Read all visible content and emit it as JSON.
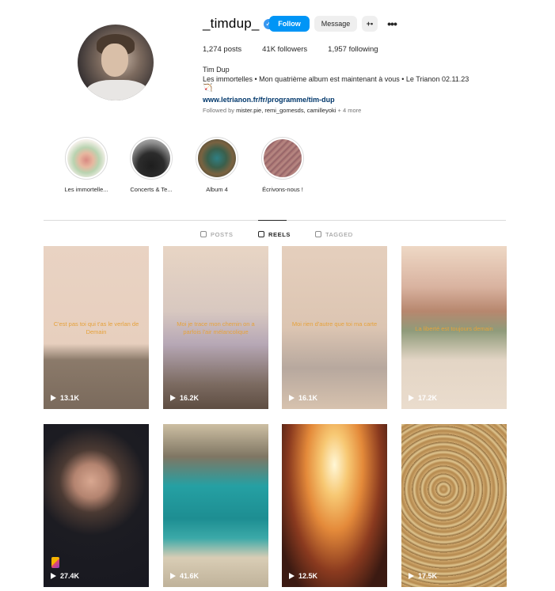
{
  "profile": {
    "username": "_timdup_",
    "verified_glyph": "✓",
    "buttons": {
      "follow": "Follow",
      "message": "Message",
      "add_user_glyph": "+•",
      "more_glyph": "•••"
    },
    "stats": {
      "posts": "1,274 posts",
      "followers": "41K followers",
      "following": "1,957 following"
    },
    "bio": {
      "name": "Tim Dup",
      "description": "Les immortelles • Mon quatrième album est maintenant à vous • Le Trianon 02.11.23",
      "emoji": "🏹",
      "link": "www.letrianon.fr/fr/programme/tim-dup"
    },
    "followed_by": {
      "prefix": "Followed by",
      "names": "mister.pie, remi_gomesds, camilleyoki",
      "more": "+ 4 more"
    }
  },
  "highlights": [
    {
      "label": "Les immortelle..."
    },
    {
      "label": "Concerts & Te..."
    },
    {
      "label": "Album 4"
    },
    {
      "label": "Écrivons-nous !"
    }
  ],
  "tabs": [
    {
      "label": "POSTS",
      "active": false
    },
    {
      "label": "REELS",
      "active": true
    },
    {
      "label": "TAGGED",
      "active": false
    }
  ],
  "reels": [
    {
      "views": "13.1K",
      "caption": "C'est pas toi qui t'as le verlan de Demain"
    },
    {
      "views": "16.2K",
      "caption": "Moi je trace mon chemin on a parfois l'air mélancolique"
    },
    {
      "views": "16.1K",
      "caption": "Moi rien d'autre que toi ma carte"
    },
    {
      "views": "17.2K",
      "caption": "La liberté est toujours demain"
    },
    {
      "views": "27.4K",
      "caption": ""
    },
    {
      "views": "41.6K",
      "caption": ""
    },
    {
      "views": "12.5K",
      "caption": ""
    },
    {
      "views": "17.5K",
      "caption": ""
    }
  ],
  "colors": {
    "accent": "#0095f6",
    "link": "#00376b",
    "verified": "#3897f0"
  },
  "icons": [
    "verified-icon",
    "add-user-icon",
    "more-icon",
    "posts-grid-icon",
    "reels-icon",
    "tagged-icon",
    "play-icon"
  ]
}
